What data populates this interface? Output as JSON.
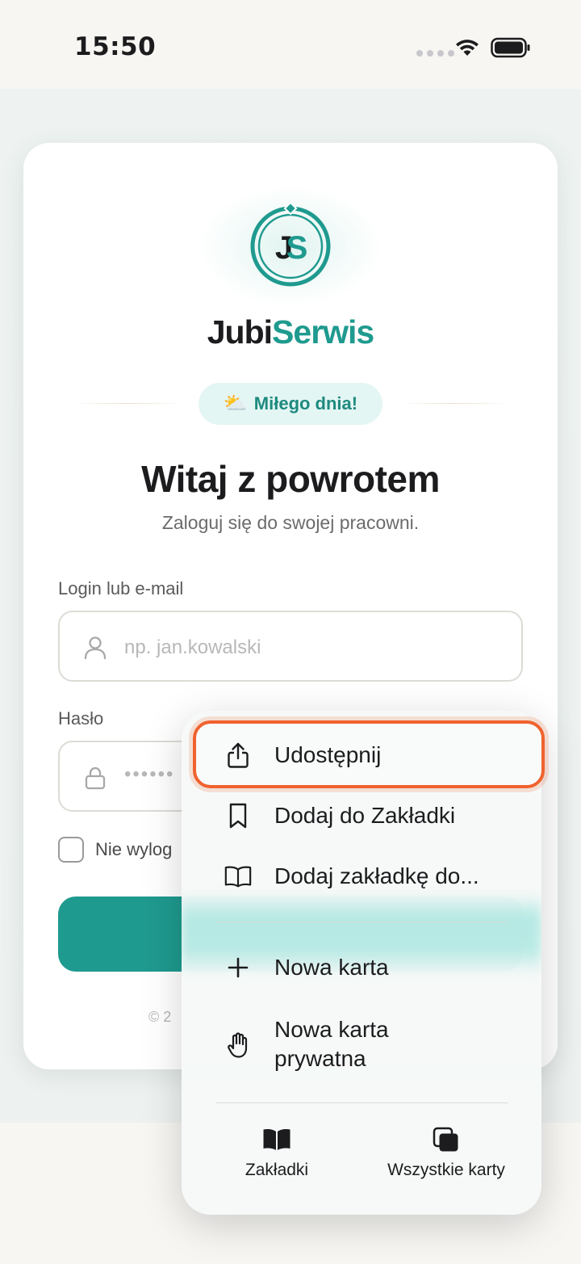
{
  "status_bar": {
    "time": "15:50"
  },
  "brand": {
    "part1": "Jubi",
    "part2": "Serwis",
    "logo_monogram": "JS",
    "accent_color": "#1f9a8f"
  },
  "greeting_badge": {
    "icon": "sun-behind-cloud-icon",
    "text": "Miłego dnia!"
  },
  "login": {
    "title": "Witaj z powrotem",
    "subtitle": "Zaloguj się do swojej pracowni.",
    "login_label": "Login lub e-mail",
    "login_placeholder": "np. jan.kowalski",
    "password_label": "Hasło",
    "password_placeholder": "••••••",
    "remember_label": "Nie wylog",
    "footer_prefix": "© 2"
  },
  "menu": {
    "items": [
      {
        "label": "Udostępnij",
        "icon": "share-icon"
      },
      {
        "label": "Dodaj do Zakładki",
        "icon": "bookmark-icon"
      },
      {
        "label": "Dodaj zakładkę do...",
        "icon": "book-open-icon"
      },
      {
        "label": "Nowa karta",
        "icon": "plus-icon"
      },
      {
        "label_line1": "Nowa karta",
        "label_line2": "prywatna",
        "icon": "hand-icon"
      }
    ],
    "bottom": {
      "bookmarks_label": "Zakładki",
      "all_tabs_label": "Wszystkie karty"
    },
    "highlight_color": "#f0622e"
  }
}
